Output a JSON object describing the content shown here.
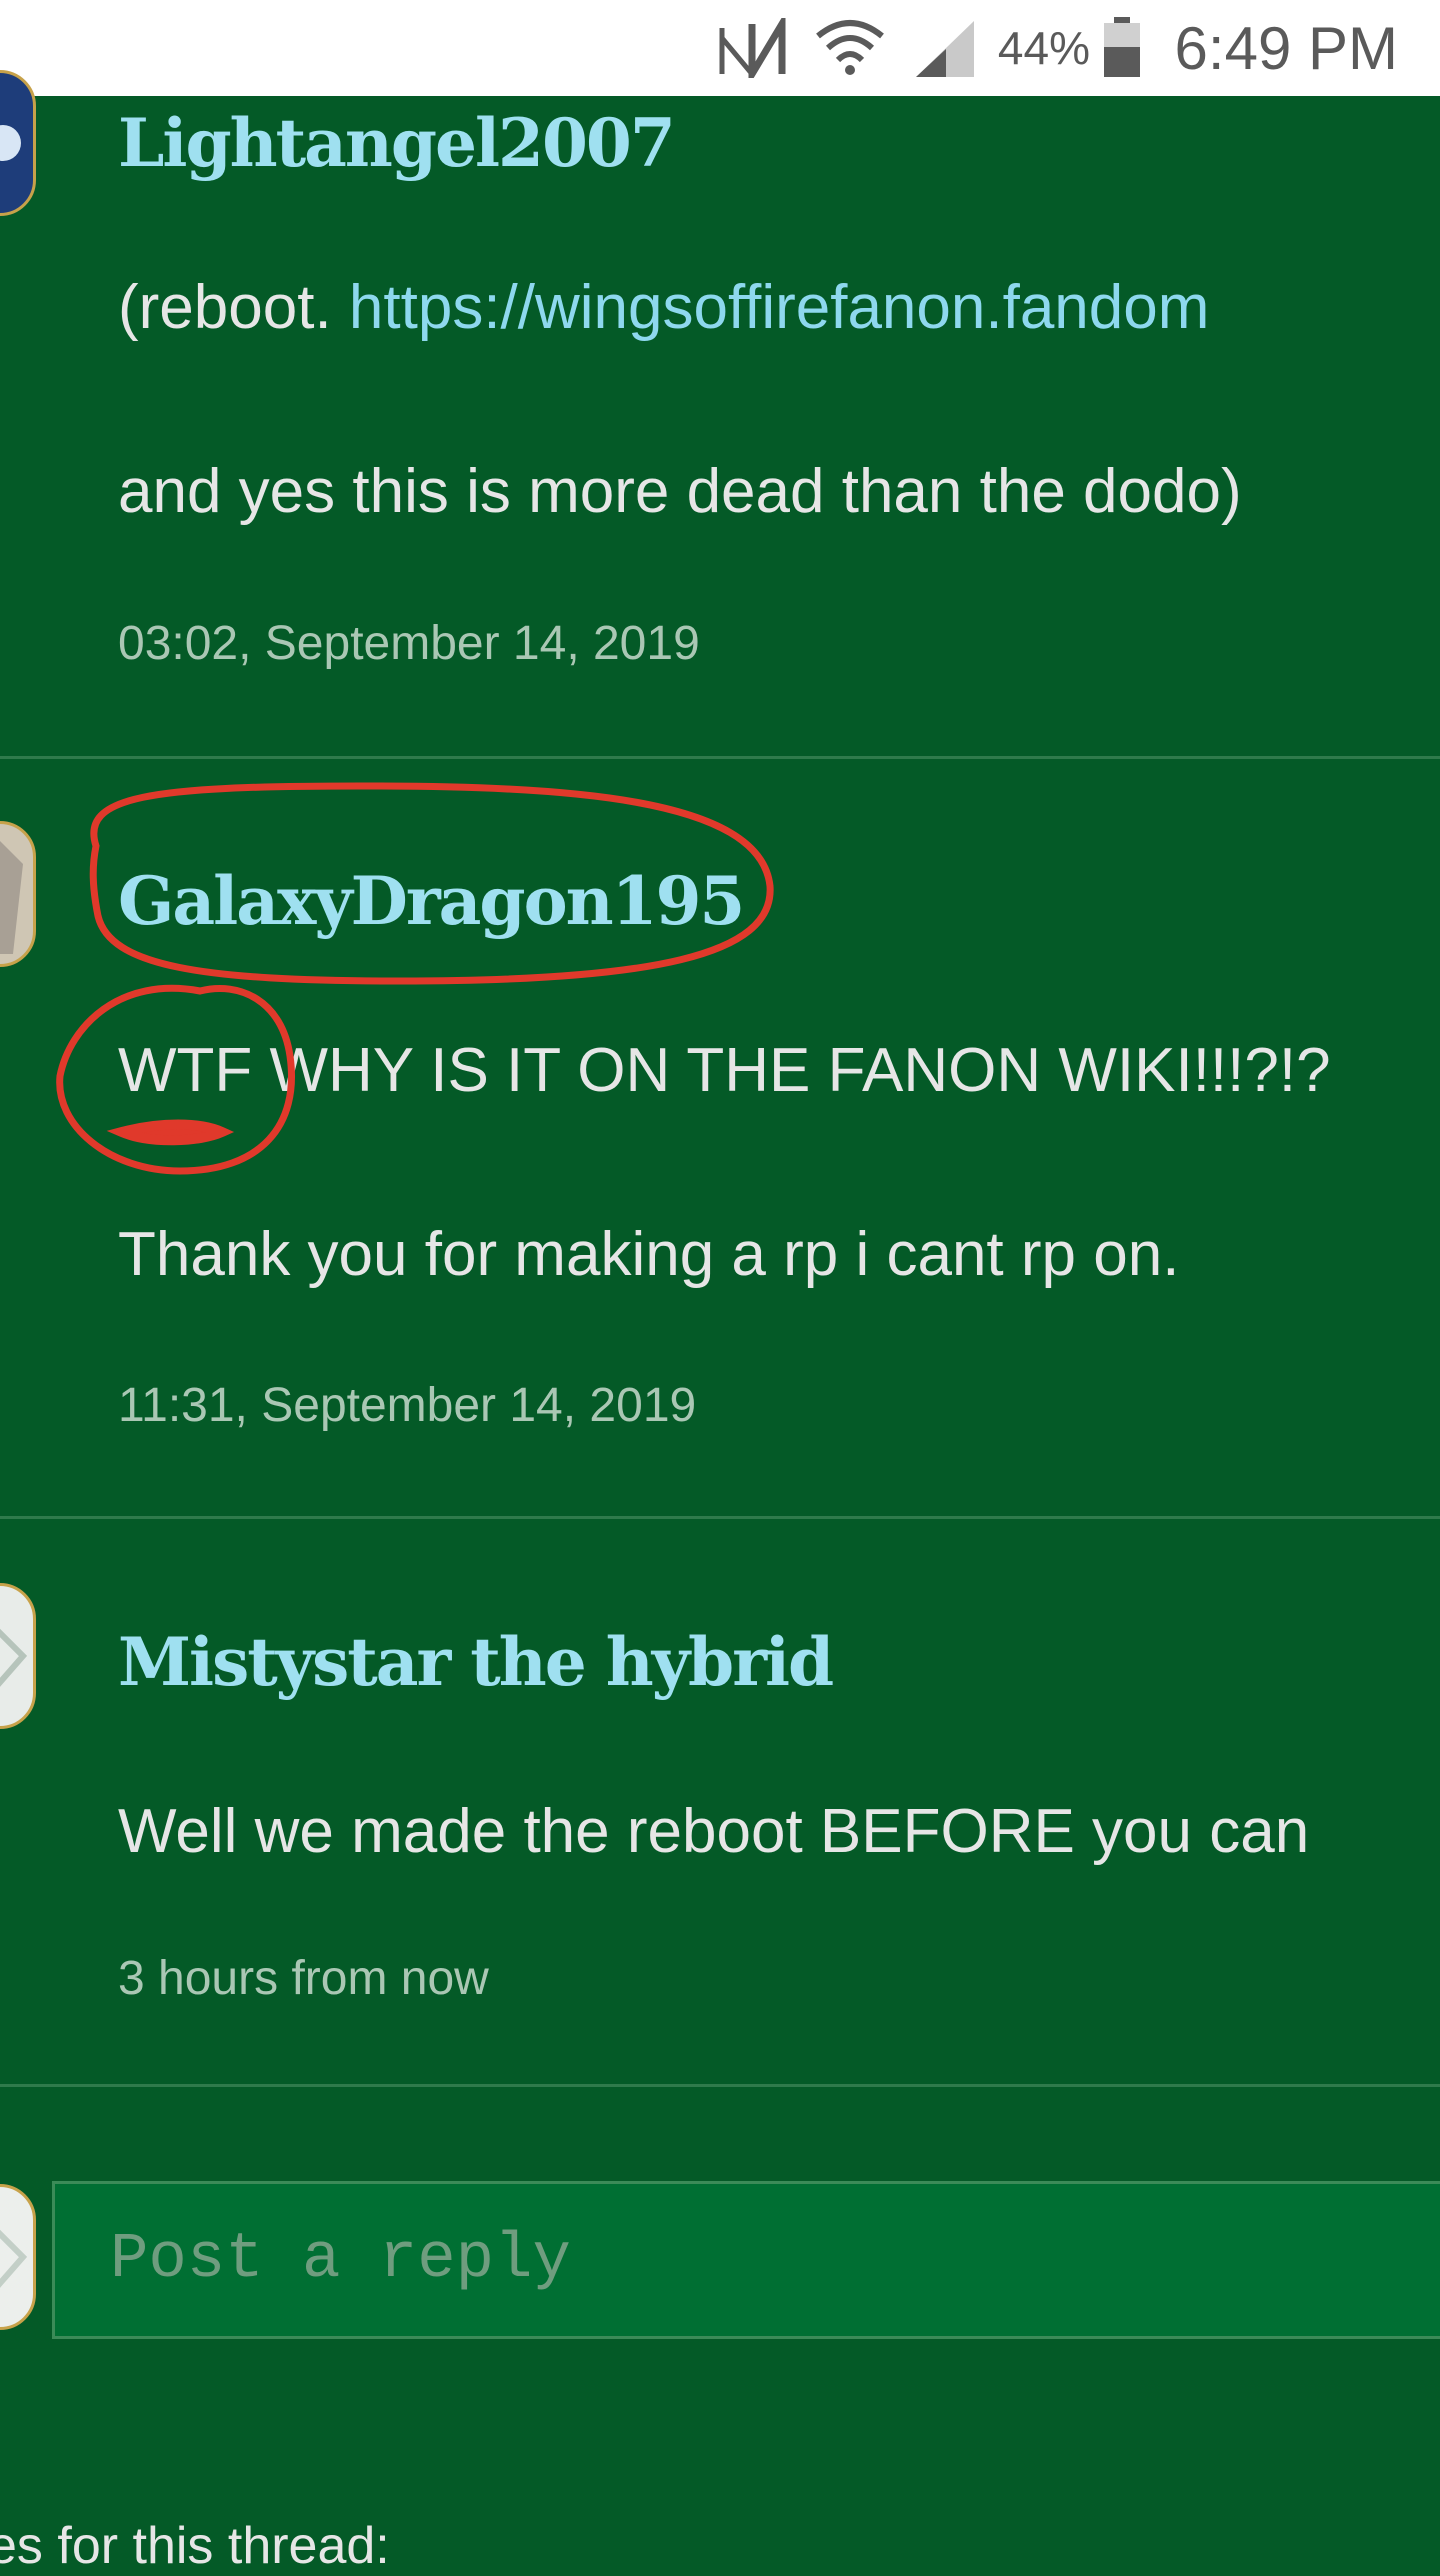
{
  "status_bar": {
    "battery_percent": "44%",
    "time": "6:49 PM",
    "icons": [
      "nfc-icon",
      "wifi-icon",
      "signal-icon",
      "battery-icon"
    ]
  },
  "posts": [
    {
      "username": "Lightangel2007",
      "lines": [
        {
          "prefix": "(reboot. ",
          "link": "https://wingsoffirefanon.fandom"
        },
        {
          "text": "and yes this is more dead than the dodo)"
        }
      ],
      "timestamp": "03:02, September 14, 2019"
    },
    {
      "username": "GalaxyDragon195",
      "lines": [
        {
          "text": "WTF WHY IS IT ON THE FANON WIKI!!!?!?"
        },
        {
          "text": "Thank you for making a rp i cant rp on."
        }
      ],
      "timestamp": "11:31, September 14, 2019"
    },
    {
      "username": "Mistystar the hybrid",
      "lines": [
        {
          "text": "Well we made the reboot BEFORE you can"
        }
      ],
      "timestamp": "3 hours from now"
    }
  ],
  "reply": {
    "placeholder": "Post a reply"
  },
  "footer": {
    "partial_text": "es for this thread:"
  },
  "colors": {
    "background": "#045a27",
    "username": "#9fe0f0",
    "link": "#8ed8ee",
    "annotation": "#e0392b"
  }
}
